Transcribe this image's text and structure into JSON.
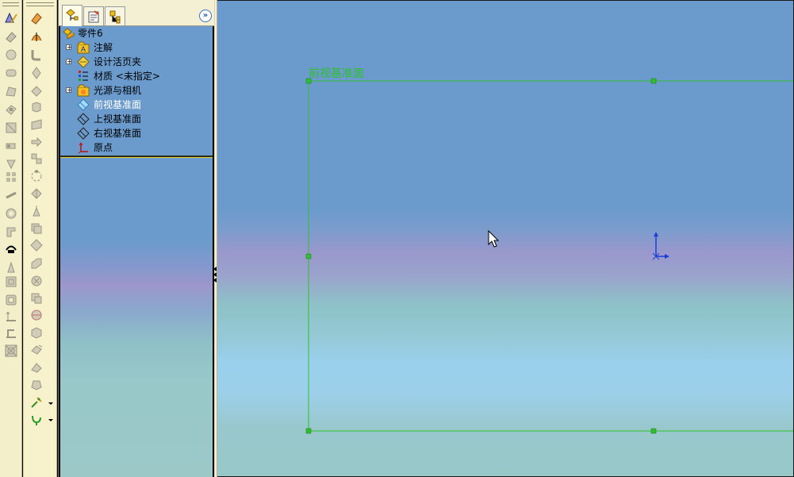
{
  "feature_tree": {
    "root_label": "零件6",
    "items": [
      {
        "label": "注解",
        "expandable": true,
        "icon": "annotations-icon",
        "highlight": false
      },
      {
        "label": "设计活页夹",
        "expandable": true,
        "icon": "design-binder-icon",
        "highlight": false
      },
      {
        "label": "材质 <未指定>",
        "expandable": false,
        "icon": "material-icon",
        "highlight": false
      },
      {
        "label": "光源与相机",
        "expandable": true,
        "icon": "lights-cameras-icon",
        "highlight": false
      },
      {
        "label": "前视基准面",
        "expandable": false,
        "icon": "plane-icon",
        "highlight": true
      },
      {
        "label": "上视基准面",
        "expandable": false,
        "icon": "plane-icon",
        "highlight": false
      },
      {
        "label": "右视基准面",
        "expandable": false,
        "icon": "plane-icon",
        "highlight": false
      },
      {
        "label": "原点",
        "expandable": false,
        "icon": "origin-icon",
        "highlight": false
      }
    ],
    "expander_glyph": "+"
  },
  "fm_tabs": [
    {
      "name": "feature-tree-tab",
      "icon": "part-tree-icon",
      "active": true
    },
    {
      "name": "property-manager-tab",
      "icon": "property-manager-icon",
      "active": false
    },
    {
      "name": "configuration-manager-tab",
      "icon": "configuration-icon",
      "active": false
    }
  ],
  "fm_expand_glyph": "»",
  "viewport": {
    "plane_label": "前视基准面",
    "plane_color": "#2fbf2f",
    "origin_color": "#1a3fd8"
  },
  "colors": {
    "toolbar_bg": "#f4f0c8",
    "tree_bg": "#6b9bcc",
    "selection_text": "#ffffff"
  }
}
